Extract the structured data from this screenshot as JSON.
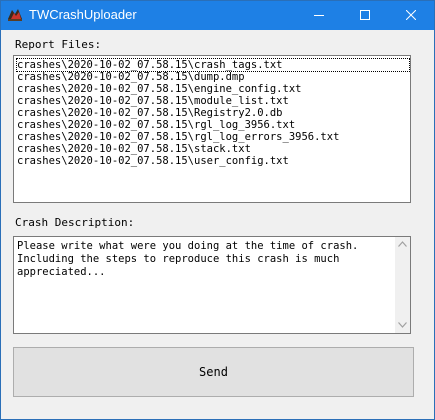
{
  "window": {
    "title": "TWCrashUploader",
    "controls": {
      "minimize_icon": "minimize-icon",
      "maximize_icon": "maximize-icon",
      "close_icon": "close-icon"
    },
    "title_bar_color": "#1e80e5"
  },
  "report_files": {
    "label": "Report Files:",
    "items": [
      "crashes\\2020-10-02_07.58.15\\crash_tags.txt",
      "crashes\\2020-10-02_07.58.15\\dump.dmp",
      "crashes\\2020-10-02_07.58.15\\engine_config.txt",
      "crashes\\2020-10-02_07.58.15\\module_list.txt",
      "crashes\\2020-10-02_07.58.15\\Registry2.0.db",
      "crashes\\2020-10-02_07.58.15\\rgl_log_3956.txt",
      "crashes\\2020-10-02_07.58.15\\rgl_log_errors_3956.txt",
      "crashes\\2020-10-02_07.58.15\\stack.txt",
      "crashes\\2020-10-02_07.58.15\\user_config.txt"
    ]
  },
  "crash_description": {
    "label": "Crash Description:",
    "lines": [
      "Please write what were you doing at the time of crash.",
      "Including the steps to reproduce this crash is much",
      "appreciated..."
    ]
  },
  "send_button": {
    "label": "Send"
  }
}
